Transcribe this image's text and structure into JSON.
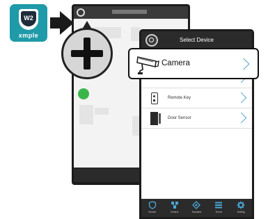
{
  "logo": {
    "badge_text": "W2",
    "brand_text": "xmple"
  },
  "select_device": {
    "title": "Select Device",
    "camera_label": "Camera",
    "items": [
      {
        "label": "Remote Key",
        "icon": "remote-key-icon"
      },
      {
        "label": "Door Sensor",
        "icon": "door-sensor-icon"
      }
    ]
  },
  "footer_tabs": [
    {
      "label": "Device",
      "icon": "shield-icon"
    },
    {
      "label": "Control",
      "icon": "network-icon"
    },
    {
      "label": "Scenario",
      "icon": "diamond-icon"
    },
    {
      "label": "Event",
      "icon": "list-icon"
    },
    {
      "label": "Setting",
      "icon": "gear-icon"
    }
  ],
  "colors": {
    "logo_bg": "#1f9aa8",
    "chevron": "#5aa3c8",
    "header_bg": "#2b2b2b"
  }
}
